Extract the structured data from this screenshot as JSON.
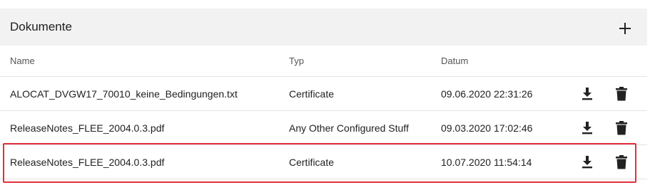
{
  "header": {
    "title": "Dokumente",
    "add_icon": "plus-icon"
  },
  "columns": {
    "name": "Name",
    "type": "Typ",
    "date": "Datum"
  },
  "rows": [
    {
      "name": "ALOCAT_DVGW17_70010_keine_Bedingungen.txt",
      "type": "Certificate",
      "date": "09.06.2020 22:31:26"
    },
    {
      "name": "ReleaseNotes_FLEE_2004.0.3.pdf",
      "type": "Any Other Configured Stuff",
      "date": "09.03.2020 17:02:46"
    },
    {
      "name": "ReleaseNotes_FLEE_2004.0.3.pdf",
      "type": "Certificate",
      "date": "10.07.2020 11:54:14",
      "highlighted": true
    }
  ],
  "row_icons": {
    "download": "download-icon",
    "delete": "trash-icon"
  },
  "colors": {
    "highlight": "#e0313b",
    "header_bg": "#f2f2f2"
  }
}
